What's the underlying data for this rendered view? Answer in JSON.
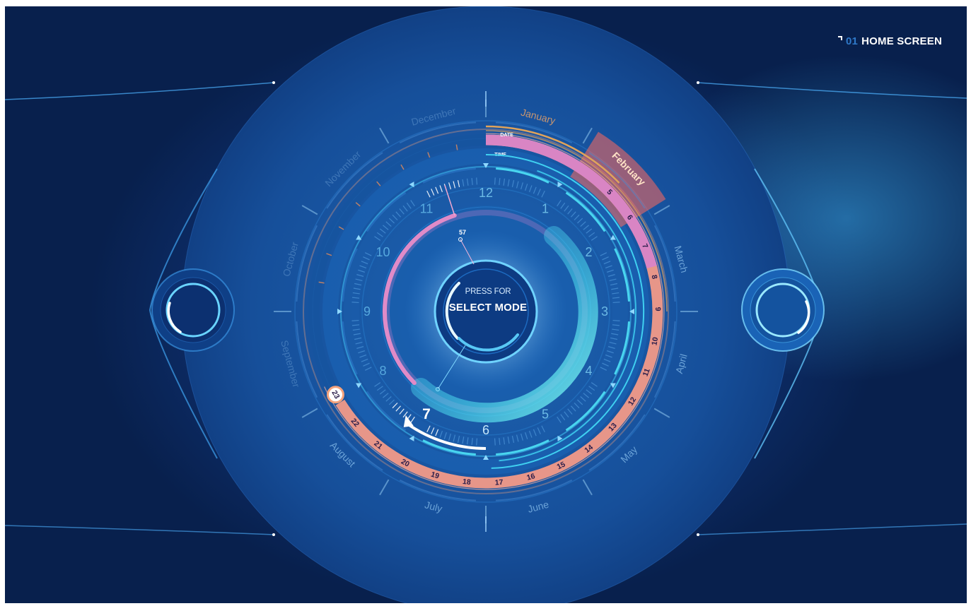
{
  "header": {
    "number": "01",
    "title": "HOME SCREEN"
  },
  "center": {
    "press": "PRESS FOR",
    "mode": "SELECT MODE"
  },
  "labels": {
    "date": "DATE",
    "time": "TIME"
  },
  "minute_marker": "57",
  "months": [
    "January",
    "February",
    "March",
    "April",
    "May",
    "June",
    "July",
    "August",
    "September",
    "October",
    "November",
    "December"
  ],
  "selected_month": "February",
  "clock_hours": [
    "12",
    "1",
    "2",
    "3",
    "4",
    "5",
    "6",
    "7",
    "8",
    "9",
    "10",
    "11"
  ],
  "current_hour": "7",
  "date_ring_days": [
    "5",
    "6",
    "7",
    "8",
    "9",
    "10",
    "11",
    "12",
    "13",
    "14",
    "15",
    "16",
    "17",
    "18",
    "19",
    "20",
    "21",
    "22"
  ],
  "current_day": "23",
  "colors": {
    "accent": "#3ed6f0",
    "date_ring": "#f29a88",
    "month_ring": "#d985c4",
    "highlight": "#ff6a5c",
    "gold": "#e0a35a"
  },
  "icons": {
    "left_control": "ring-knob-icon",
    "right_control": "ring-knob-icon"
  }
}
